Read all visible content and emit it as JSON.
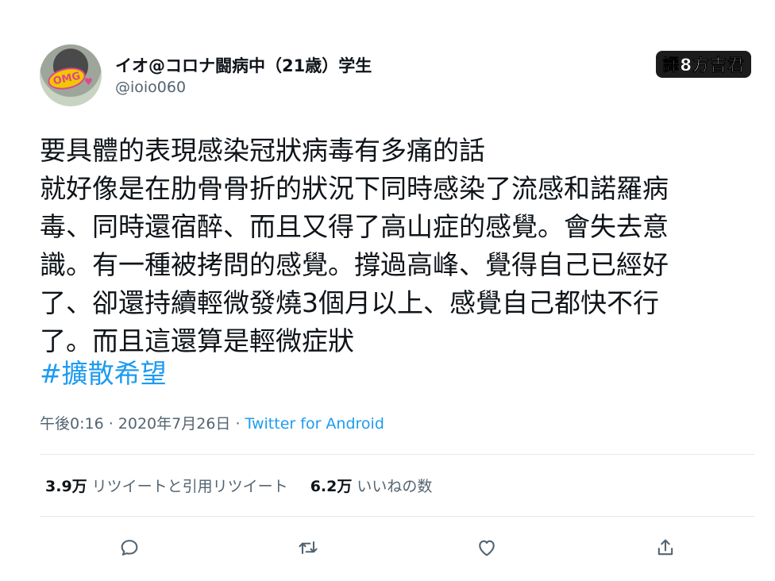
{
  "tweet": {
    "display_name": "イオ@コロナ闘病中（21歳）学生",
    "handle": "@ioio060",
    "avatar_text": "OMG",
    "translator_mark": "譯8方吉君",
    "body_lines": [
      "要具體的表現感染冠狀病毒有多痛的話",
      "就好像是在肋骨骨折的狀況下同時感染了流感和諾羅病",
      "毒、同時還宿醉、而且又得了高山症的感覺。會失去意",
      "識。有一種被拷問的感覺。撐過高峰、覺得自己已經好",
      "了、卻還持續輕微發燒3個月以上、感覺自己都快不行",
      "了。而且這還算是輕微症狀"
    ],
    "hashtag": "#擴散希望",
    "timestamp": "午後0:16 · 2020年7月26日 · ",
    "source": "Twitter for Android",
    "stats": {
      "retweets_count": "3.9万",
      "retweets_label": "リツイートと引用リツイート",
      "likes_count": "6.2万",
      "likes_label": "いいねの数"
    },
    "actions": {
      "reply_icon": "reply-icon",
      "retweet_icon": "retweet-icon",
      "like_icon": "heart-icon",
      "share_icon": "share-icon"
    }
  },
  "colors": {
    "link": "#1d9bf0",
    "secondary_text": "#536471",
    "primary_text": "#0f1419",
    "divider": "#e5e8eb"
  }
}
